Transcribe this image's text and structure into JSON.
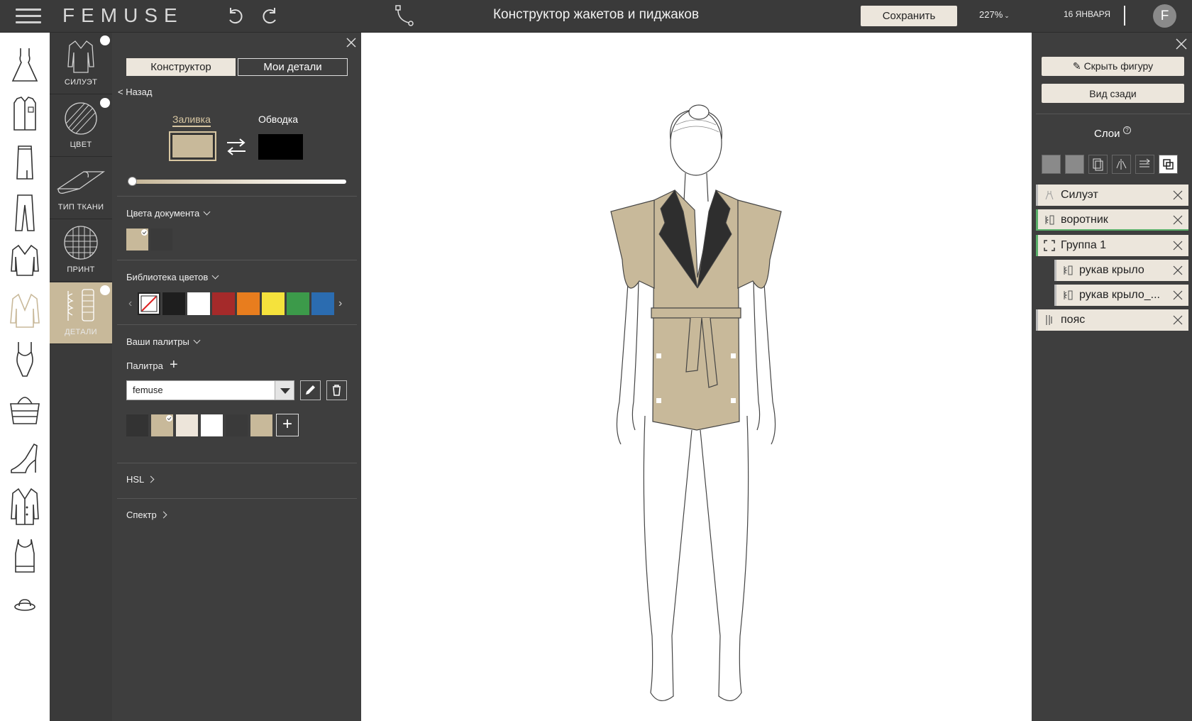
{
  "topbar": {
    "logo": "FEMUSE",
    "title": "Конструктор жакетов и пиджаков",
    "save_label": "Сохранить",
    "zoom": "227%",
    "date": "16 ЯНВАРЯ",
    "avatar_letter": "F"
  },
  "left_categories": [
    "dress-icon",
    "shirt-icon",
    "skirt-icon",
    "trousers-icon",
    "sweater-icon",
    "jacket-icon",
    "swimsuit-icon",
    "bag-icon",
    "heel-shoe-icon",
    "coat-icon",
    "tank-top-icon",
    "hat-icon"
  ],
  "steps": [
    {
      "label": "СИЛУЭТ",
      "checked": true
    },
    {
      "label": "ЦВЕТ",
      "checked": true
    },
    {
      "label": "ТИП ТКАНИ",
      "checked": false
    },
    {
      "label": "ПРИНТ",
      "checked": false
    },
    {
      "label": "ДЕТАЛИ",
      "checked": true,
      "active": true
    }
  ],
  "panel": {
    "tab_constructor": "Конструктор",
    "tab_my_details": "Мои детали",
    "back": "< Назад",
    "fill_label": "Заливка",
    "stroke_label": "Обводка",
    "fill_color": "#c8b99a",
    "stroke_color": "#000000",
    "doc_colors_label": "Цвета документа",
    "doc_colors": [
      "#c8b99a",
      "#3a3a3a"
    ],
    "library_label": "Библиотека цветов",
    "library_colors": [
      "none",
      "#1e1e1e",
      "#ffffff",
      "#a52a2a",
      "#e87d1e",
      "#f5e23c",
      "#3c9a4a",
      "#2b6cb0"
    ],
    "your_palettes_label": "Ваши палитры",
    "palette_label": "Палитра",
    "palette_selected": "femuse",
    "palette_colors": [
      "#333333",
      "#c8b99a",
      "#ede5da",
      "#ffffff",
      "#3a3a3a",
      "#c8b99a"
    ],
    "hsl_label": "HSL",
    "spectrum_label": "Спектр"
  },
  "right_panel": {
    "hide_figure": "Скрыть фигуру",
    "back_view": "Вид сзади",
    "layers_title": "Слои",
    "layers": [
      {
        "name": "Силуэт",
        "icon": "figure-icon",
        "indent": false
      },
      {
        "name": "воротник",
        "icon": "detail-icon",
        "indent": false
      },
      {
        "name": "Группа 1",
        "icon": "group-icon",
        "indent": false
      },
      {
        "name": "рукав крыло",
        "icon": "detail-icon",
        "indent": true
      },
      {
        "name": "рукав крыло_...",
        "icon": "detail-icon",
        "indent": true
      },
      {
        "name": "пояс",
        "icon": "belt-icon",
        "indent": false
      }
    ]
  },
  "colors": {
    "accent": "#c8b99a",
    "panel_bg": "#3e3e3e",
    "light_btn": "#ece6dc"
  }
}
